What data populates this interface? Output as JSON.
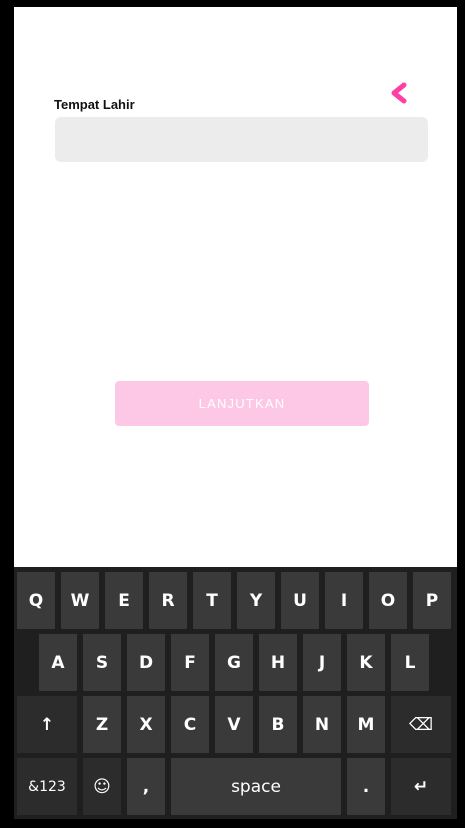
{
  "form": {
    "field_label": "Tempat Lahir",
    "field_value": "",
    "submit_label": "LANJUTKAN",
    "accent_color": "#ff3fa4",
    "button_color": "#fdc8e6"
  },
  "keyboard": {
    "row1": [
      "Q",
      "W",
      "E",
      "R",
      "T",
      "Y",
      "U",
      "I",
      "O",
      "P"
    ],
    "row2": [
      "A",
      "S",
      "D",
      "F",
      "G",
      "H",
      "J",
      "K",
      "L"
    ],
    "row3": [
      "Z",
      "X",
      "C",
      "V",
      "B",
      "N",
      "M"
    ],
    "shift": "↑",
    "backspace": "⌫",
    "numbers": "&123",
    "emoji": "☺",
    "comma": ",",
    "space": "space",
    "period": ".",
    "enter": "↵"
  }
}
